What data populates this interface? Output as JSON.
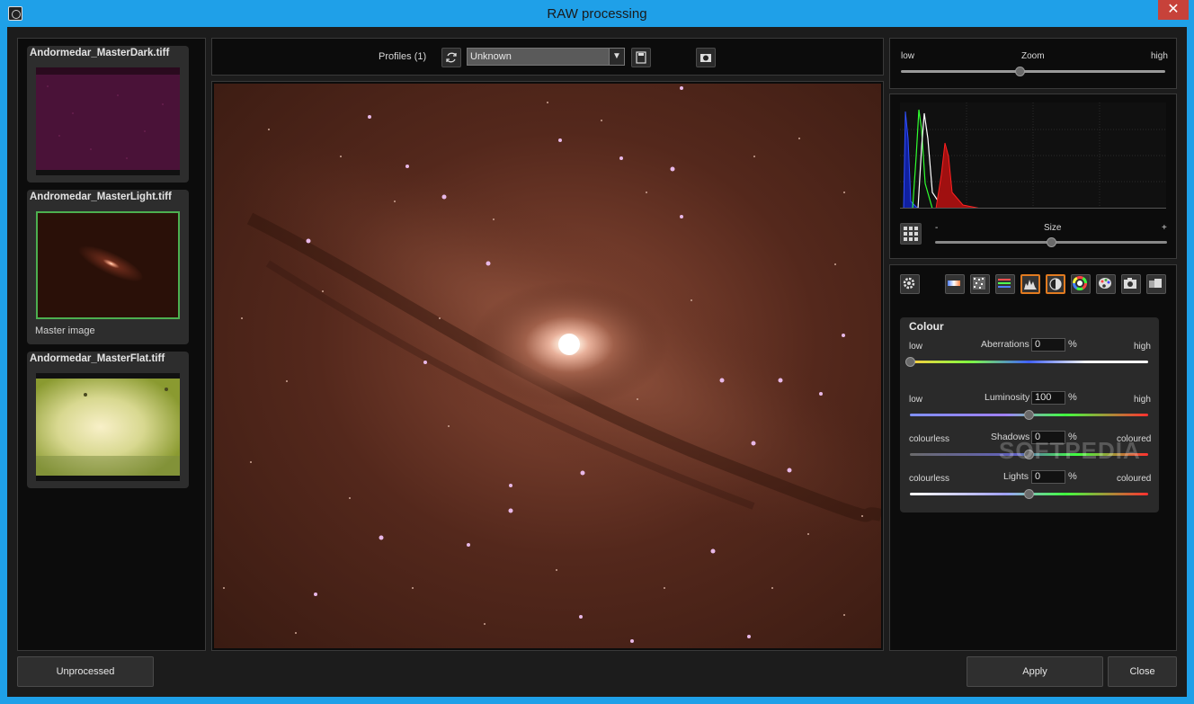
{
  "window": {
    "title": "RAW processing",
    "close": "✕"
  },
  "thumbnails": [
    {
      "name": "Andormedar_MasterDark.tiff",
      "caption": ""
    },
    {
      "name": "Andromedar_MasterLight.tiff",
      "caption": "Master image"
    },
    {
      "name": "Andormedar_MasterFlat.tiff",
      "caption": ""
    }
  ],
  "toolbar": {
    "profiles_label": "Profiles (1)",
    "profile_value": "Unknown"
  },
  "zoom": {
    "low": "low",
    "label": "Zoom",
    "high": "high",
    "level": 0.45
  },
  "histogram": {
    "size_minus": "-",
    "size_label": "Size",
    "size_plus": "+",
    "size_level": 0.5
  },
  "colour": {
    "title": "Colour",
    "aberrations": {
      "left": "low",
      "label": "Aberrations",
      "value": "0",
      "unit": "%",
      "right": "high",
      "level": 0.0
    },
    "luminosity": {
      "left": "low",
      "label": "Luminosity",
      "value": "100",
      "unit": "%",
      "right": "high",
      "level": 0.5
    },
    "shadows": {
      "left": "colourless",
      "label": "Shadows",
      "value": "0",
      "unit": "%",
      "right": "coloured",
      "level": 0.5
    },
    "lights": {
      "left": "colourless",
      "label": "Lights",
      "value": "0",
      "unit": "%",
      "right": "coloured",
      "level": 0.5
    }
  },
  "watermark": "SOFTPEDIA",
  "buttons": {
    "unprocessed": "Unprocessed",
    "apply": "Apply",
    "close": "Close"
  },
  "colors": {
    "titlebar": "#1fa0e8",
    "active_tool": "#e07a20",
    "master_border": "#4caf50"
  }
}
